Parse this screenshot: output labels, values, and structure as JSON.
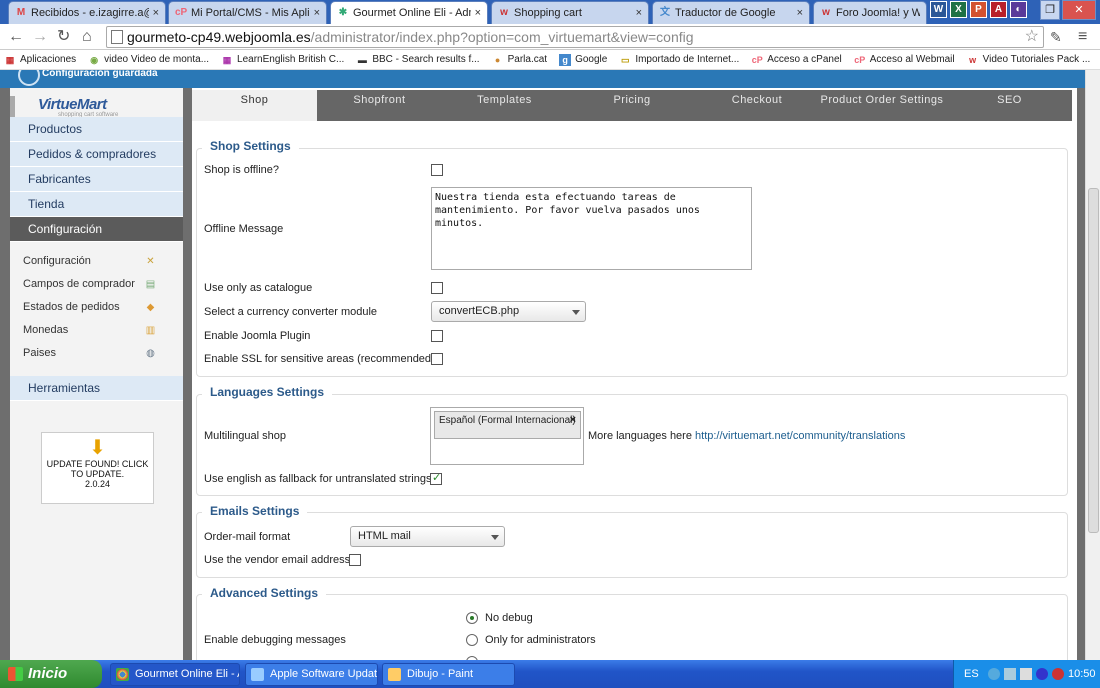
{
  "browser": {
    "tabs": [
      {
        "label": "Recibidos - e.izagirre.a@gm",
        "icon": "gmail-icon",
        "glyph": "M",
        "color": "#d44"
      },
      {
        "label": "Mi Portal/CMS - Mis Aplicacio",
        "icon": "cpanel-icon",
        "glyph": "cP",
        "color": "#e67"
      },
      {
        "label": "Gourmet Online Eli - Adminis",
        "icon": "joomla-icon",
        "glyph": "✱",
        "color": "#3a7"
      },
      {
        "label": "Shopping cart",
        "icon": "webjoomla-icon",
        "glyph": "w",
        "color": "#c33"
      },
      {
        "label": "Traductor de Google",
        "icon": "google-translate-icon",
        "glyph": "文",
        "color": "#48c"
      },
      {
        "label": "Foro Joomla! y Wor",
        "icon": "webjoomla-icon",
        "glyph": "w",
        "color": "#c33"
      }
    ],
    "close_glyph": "×",
    "url": {
      "host": "gourmeto-cp49.webjoomla.es",
      "path": "/administrator/index.php?option=com_virtuemart&view=config"
    },
    "bookmarks": [
      {
        "label": "Aplicaciones",
        "icon": "apps-icon",
        "glyph": "▦",
        "color": "#c33"
      },
      {
        "label": "video Video de monta...",
        "icon": "video-icon",
        "glyph": "◉",
        "color": "#7a4"
      },
      {
        "label": "LearnEnglish British C...",
        "icon": "british-council-icon",
        "glyph": "▦",
        "color": "#a3a"
      },
      {
        "label": "BBC - Search results f...",
        "icon": "bbc-icon",
        "glyph": "▬",
        "color": "#333"
      },
      {
        "label": "Parla.cat",
        "icon": "parla-icon",
        "glyph": "●",
        "color": "#c83"
      },
      {
        "label": "Google",
        "icon": "google-icon",
        "glyph": "g",
        "color": "#48c"
      },
      {
        "label": "Importado de Internet...",
        "icon": "folder-icon",
        "glyph": "▭",
        "color": "#b90"
      },
      {
        "label": "Acceso a cPanel",
        "icon": "cpanel-icon",
        "glyph": "cP",
        "color": "#e67"
      },
      {
        "label": "Acceso al Webmail",
        "icon": "cpanel-icon",
        "glyph": "cP",
        "color": "#e67"
      },
      {
        "label": "Video Tutoriales Pack ...",
        "icon": "webjoomla-icon",
        "glyph": "w",
        "color": "#c33"
      }
    ]
  },
  "notice": "Configuración guardada",
  "sidebar": {
    "logo": "VirtueMart",
    "logo_sub": "shopping cart software",
    "main_items": [
      {
        "label": "Productos"
      },
      {
        "label": "Pedidos & compradores"
      },
      {
        "label": "Fabricantes"
      },
      {
        "label": "Tienda"
      },
      {
        "label": "Configuración"
      }
    ],
    "sub_items": [
      {
        "label": "Configuración",
        "icon": "tools-icon",
        "glyph": "✕"
      },
      {
        "label": "Campos de comprador",
        "icon": "form-icon",
        "glyph": "▤"
      },
      {
        "label": "Estados de pedidos",
        "icon": "status-icon",
        "glyph": "◆"
      },
      {
        "label": "Monedas",
        "icon": "coins-icon",
        "glyph": "▥"
      },
      {
        "label": "Paises",
        "icon": "globe-icon",
        "glyph": "◍"
      }
    ],
    "tools": "Herramientas",
    "update": {
      "line1": "UPDATE FOUND! CLICK",
      "line2": "TO UPDATE.",
      "version": "2.0.24"
    }
  },
  "tabs": [
    "Shop",
    "Shopfront",
    "Templates",
    "Pricing",
    "Checkout",
    "Product Order Settings",
    "SEO"
  ],
  "shop_settings": {
    "legend": "Shop Settings",
    "offline_label": "Shop is offline?",
    "offline_msg_label": "Offline Message",
    "offline_msg": "Nuestra tienda esta efectuando tareas de mantenimiento. Por favor vuelva pasados unos minutos.",
    "catalogue_label": "Use only as catalogue",
    "currency_label": "Select a currency converter module",
    "currency_value": "convertECB.php",
    "joomla_plugin_label": "Enable Joomla Plugin",
    "ssl_label": "Enable SSL for sensitive areas (recommended)"
  },
  "languages": {
    "legend": "Languages Settings",
    "multilingual_label": "Multilingual shop",
    "chip": "Español (Formal Internacional)",
    "chip_remove": "×",
    "more_text": "More languages here",
    "more_link": "http://virtuemart.net/community/translations",
    "fallback_label": "Use english as fallback for untranslated strings"
  },
  "emails": {
    "legend": "Emails Settings",
    "format_label": "Order-mail format",
    "format_value": "HTML mail",
    "vendor_label": "Use the vendor email address"
  },
  "advanced": {
    "legend": "Advanced Settings",
    "debug_label": "Enable debugging messages",
    "opt_no_debug": "No debug",
    "opt_admins": "Only for administrators"
  },
  "taskbar": {
    "start": "Inicio",
    "tasks": [
      "Gourmet Online Eli - A...",
      "Apple Software Update",
      "Dibujo - Paint"
    ],
    "lang": "ES",
    "time": "10:50"
  }
}
